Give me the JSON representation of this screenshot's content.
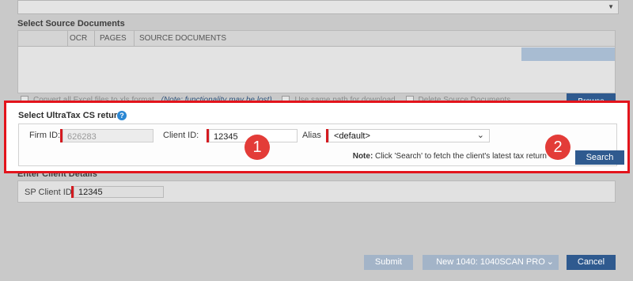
{
  "background": {
    "source_section_title": "Select Source Documents",
    "table_headers": [
      "OCR",
      "PAGES",
      "SOURCE DOCUMENTS"
    ],
    "ghost_options": {
      "convert_label": "Convert all Excel files to xls format",
      "note_link": "(Note: functionality may be lost)",
      "same_path_label": "Use same path for download",
      "delete_label": "Delete Source Documents"
    },
    "browse_label": "Browse",
    "client_section_title": "Enter Client Details",
    "sp_client_label": "SP Client ID:",
    "sp_client_value": "12345",
    "submit_label": "Submit",
    "template_value": "New 1040: 1040SCAN PRO",
    "cancel_label": "Cancel"
  },
  "dialog": {
    "title": "Select UltraTax CS  return",
    "help_icon": "?",
    "firm_label": "Firm ID:",
    "firm_value": "626283",
    "client_label": "Client ID:",
    "client_value": "12345",
    "alias_label": "Alias",
    "alias_value": "<default>",
    "note_bold": "Note:",
    "note_text": " Click 'Search' to fetch the client's latest tax return",
    "search_label": "Search"
  },
  "callouts": [
    "1",
    "2"
  ],
  "colors": {
    "highlight_border": "#e3141c",
    "primary_button": "#2f5a8f",
    "callout": "#e33c38",
    "required_marker": "#d41a20"
  }
}
